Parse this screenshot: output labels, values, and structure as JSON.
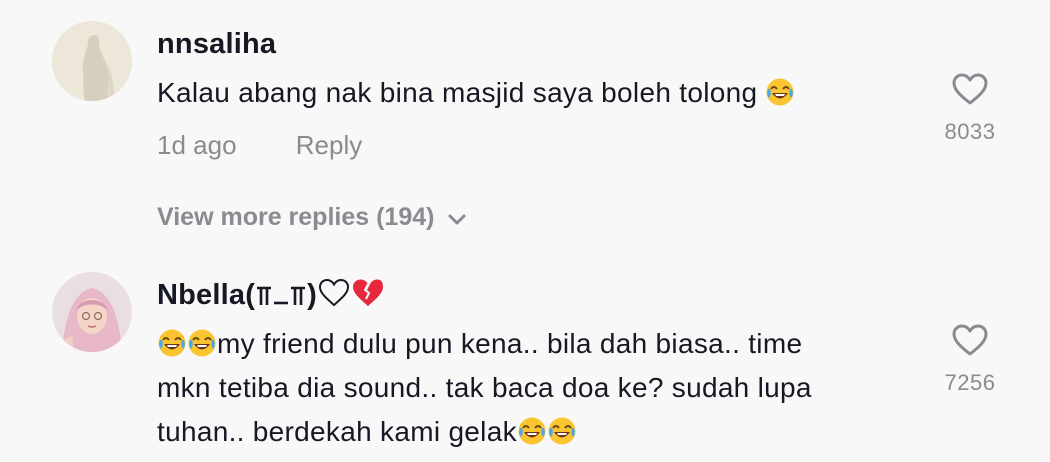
{
  "comments": [
    {
      "username": "nnsaliha",
      "text": "Kalau abang nak bina masjid saya boleh tolong",
      "emoji_suffix": [
        "laughing-tears-emoji"
      ],
      "timestamp": "1d ago",
      "reply_label": "Reply",
      "like_count": "8033",
      "view_more_replies": "View more replies (194)"
    },
    {
      "username": "Nbella(╥_╥)♡💔",
      "username_text": "Nbella(",
      "text_line1": "my friend dulu pun kena.. bila dah biasa.. time",
      "text_line2": "mkn tetiba dia sound.. tak baca doa ke? sudah lupa",
      "text_line3": "tuhan.. berdekah kami gelak",
      "like_count": "7256"
    }
  ],
  "colors": {
    "background": "#f8f8f8",
    "text_primary": "#161823",
    "text_secondary": "#8a8b91",
    "heart_stroke": "#8a8b91"
  },
  "icons": [
    "heart-outline-icon",
    "chevron-down-icon",
    "laughing-tears-emoji",
    "broken-heart-emoji"
  ]
}
